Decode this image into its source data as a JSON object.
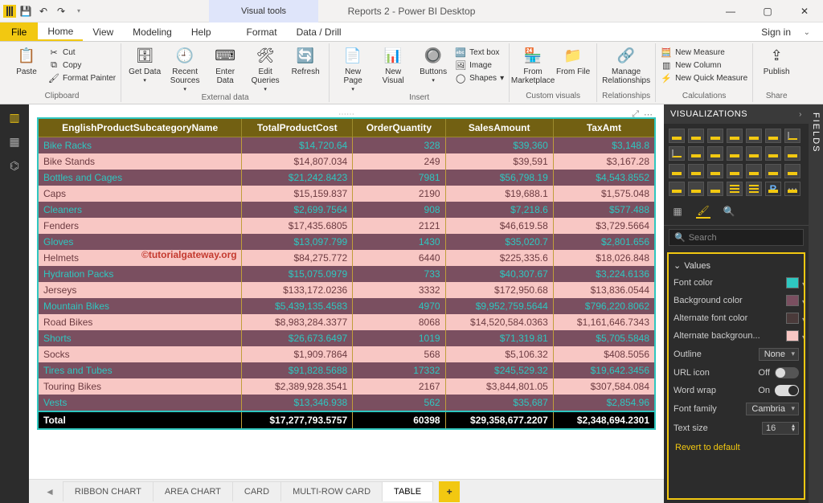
{
  "window": {
    "contextual_tab": "Visual tools",
    "title": "Reports 2 - Power BI Desktop",
    "sign_in": "Sign in"
  },
  "menu": {
    "file": "File",
    "tabs": [
      "Home",
      "View",
      "Modeling",
      "Help",
      "Format",
      "Data / Drill"
    ],
    "selected": 0
  },
  "ribbon": {
    "clipboard": {
      "label": "Clipboard",
      "paste": "Paste",
      "cut": "Cut",
      "copy": "Copy",
      "format_painter": "Format Painter"
    },
    "external": {
      "label": "External data",
      "get": "Get Data",
      "recent": "Recent Sources",
      "enter": "Enter Data",
      "edit": "Edit Queries",
      "refresh": "Refresh"
    },
    "insert": {
      "label": "Insert",
      "new_page": "New Page",
      "new_visual": "New Visual",
      "buttons": "Buttons",
      "text_box": "Text box",
      "image": "Image",
      "shapes": "Shapes"
    },
    "custom": {
      "label": "Custom visuals",
      "marketplace": "From Marketplace",
      "file": "From File"
    },
    "rel": {
      "label": "Relationships",
      "manage": "Manage Relationships"
    },
    "calc": {
      "label": "Calculations",
      "new_measure": "New Measure",
      "new_column": "New Column",
      "new_quick": "New Quick Measure"
    },
    "share": {
      "label": "Share",
      "publish": "Publish"
    }
  },
  "watermark": "©tutorialgateway.org",
  "chart_data": {
    "type": "table",
    "columns": [
      "EnglishProductSubcategoryName",
      "TotalProductCost",
      "OrderQuantity",
      "SalesAmount",
      "TaxAmt"
    ],
    "rows": [
      [
        "Bike Racks",
        "$14,720.64",
        "328",
        "$39,360",
        "$3,148.8"
      ],
      [
        "Bike Stands",
        "$14,807.034",
        "249",
        "$39,591",
        "$3,167.28"
      ],
      [
        "Bottles and Cages",
        "$21,242.8423",
        "7981",
        "$56,798.19",
        "$4,543.8552"
      ],
      [
        "Caps",
        "$15,159.837",
        "2190",
        "$19,688.1",
        "$1,575.048"
      ],
      [
        "Cleaners",
        "$2,699.7564",
        "908",
        "$7,218.6",
        "$577.488"
      ],
      [
        "Fenders",
        "$17,435.6805",
        "2121",
        "$46,619.58",
        "$3,729.5664"
      ],
      [
        "Gloves",
        "$13,097.799",
        "1430",
        "$35,020.7",
        "$2,801.656"
      ],
      [
        "Helmets",
        "$84,275.772",
        "6440",
        "$225,335.6",
        "$18,026.848"
      ],
      [
        "Hydration Packs",
        "$15,075.0979",
        "733",
        "$40,307.67",
        "$3,224.6136"
      ],
      [
        "Jerseys",
        "$133,172.0236",
        "3332",
        "$172,950.68",
        "$13,836.0544"
      ],
      [
        "Mountain Bikes",
        "$5,439,135.4583",
        "4970",
        "$9,952,759.5644",
        "$796,220.8062"
      ],
      [
        "Road Bikes",
        "$8,983,284.3377",
        "8068",
        "$14,520,584.0363",
        "$1,161,646.7343"
      ],
      [
        "Shorts",
        "$26,673.6497",
        "1019",
        "$71,319.81",
        "$5,705.5848"
      ],
      [
        "Socks",
        "$1,909.7864",
        "568",
        "$5,106.32",
        "$408.5056"
      ],
      [
        "Tires and Tubes",
        "$91,828.5688",
        "17332",
        "$245,529.32",
        "$19,642.3456"
      ],
      [
        "Touring Bikes",
        "$2,389,928.3541",
        "2167",
        "$3,844,801.05",
        "$307,584.084"
      ],
      [
        "Vests",
        "$13,346.938",
        "562",
        "$35,687",
        "$2,854.96"
      ]
    ],
    "total_row": [
      "Total",
      "$17,277,793.5757",
      "60398",
      "$29,358,677.2207",
      "$2,348,694.2301"
    ]
  },
  "page_tabs": {
    "items": [
      "RIBBON CHART",
      "AREA CHART",
      "CARD",
      "MULTI-ROW CARD",
      "TABLE"
    ],
    "selected": 4
  },
  "viz_pane": {
    "title": "VISUALIZATIONS",
    "search": "Search"
  },
  "format": {
    "section": "Values",
    "font_color": {
      "label": "Font color",
      "value": "#2ec7c0"
    },
    "bg_color": {
      "label": "Background color",
      "value": "#7a4f60"
    },
    "alt_font": {
      "label": "Alternate font color",
      "value": "#4a3a3a"
    },
    "alt_bg": {
      "label": "Alternate backgroun...",
      "value": "#f8c7c4"
    },
    "outline": {
      "label": "Outline",
      "value": "None"
    },
    "url_icon": {
      "label": "URL icon",
      "value": "Off"
    },
    "word_wrap": {
      "label": "Word wrap",
      "value": "On"
    },
    "font_family": {
      "label": "Font family",
      "value": "Cambria"
    },
    "text_size": {
      "label": "Text size",
      "value": "16"
    },
    "revert": "Revert to default"
  },
  "fields_pane": {
    "title": "FIELDS"
  }
}
